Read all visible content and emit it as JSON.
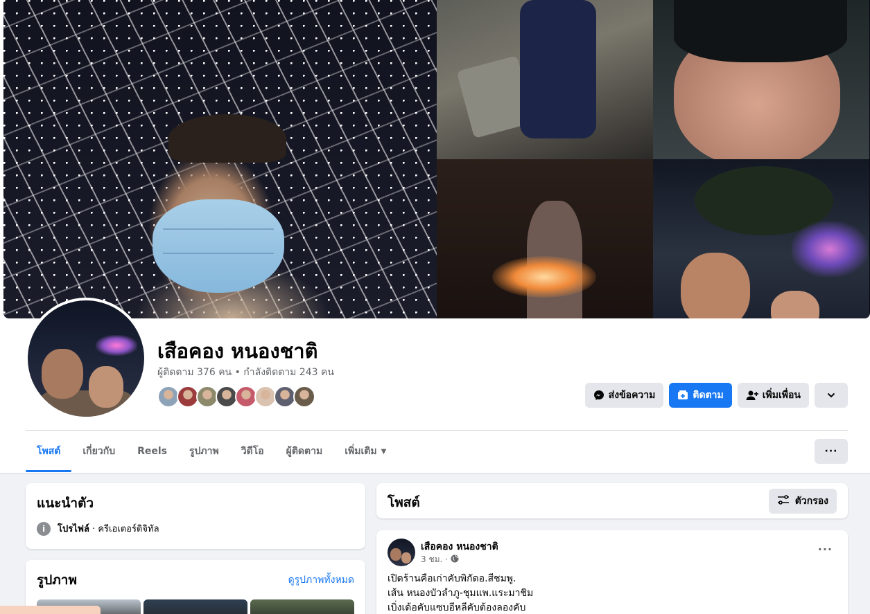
{
  "profile": {
    "name": "เสือคอง หนองชาติ",
    "stats": "ผู้ติดตาม 376 คน • กำลังติดตาม 243 คน",
    "friend_avatar_colors": [
      "#8fa3b8",
      "#9b3b3b",
      "#8c8a6b",
      "#4a4a4a",
      "#c55a6a",
      "#d9c3b0",
      "#5e6070",
      "#6a5c4a"
    ]
  },
  "actions": {
    "message_label": "ส่งข้อความ",
    "follow_label": "ติดตาม",
    "add_friend_label": "เพิ่มเพื่อน"
  },
  "tabs": {
    "items": [
      {
        "label": "โพสต์"
      },
      {
        "label": "เกี่ยวกับ"
      },
      {
        "label": "Reels"
      },
      {
        "label": "รูปภาพ"
      },
      {
        "label": "วิดีโอ"
      },
      {
        "label": "ผู้ติดตาม"
      },
      {
        "label": "เพิ่มเติม"
      }
    ],
    "more_menu": "···"
  },
  "intro": {
    "title": "แนะนำตัว",
    "profile_label": "โปรไฟล์",
    "profile_category": " · ครีเอเตอร์ดิจิทัล"
  },
  "photos": {
    "title": "รูปภาพ",
    "see_all": "ดูรูปภาพทั้งหมด",
    "thumb_colors": [
      "#b9c3cc",
      "#2f3f52",
      "#5a6b4e"
    ]
  },
  "posts": {
    "title": "โพสต์",
    "filter_label": "ตัวกรอง",
    "items": [
      {
        "author": "เสือคอง หนองชาติ",
        "time": "3 ชม. ·",
        "lines": [
          "เปิดร้านคือเก่าคับพิกัดอ.สีชมพู.",
          "เส้น หนองบัวลำภู-ชุมแพ.แระมาชิม",
          "เบิ่งเด้อคับแซบอีหลีคับต้องลองคับ"
        ],
        "more": "···"
      }
    ]
  },
  "colors": {
    "accent": "#1877f2",
    "page_bg": "#f0f2f5",
    "secondary_btn": "#e4e6eb",
    "muted_text": "#65676b"
  },
  "icons": {
    "message": "messenger-icon",
    "follow": "follow-icon",
    "add_friend": "add-friend-icon",
    "expand": "chevron-down-icon",
    "info": "info-icon",
    "filter": "filter-icon",
    "privacy": "globe-icon"
  }
}
